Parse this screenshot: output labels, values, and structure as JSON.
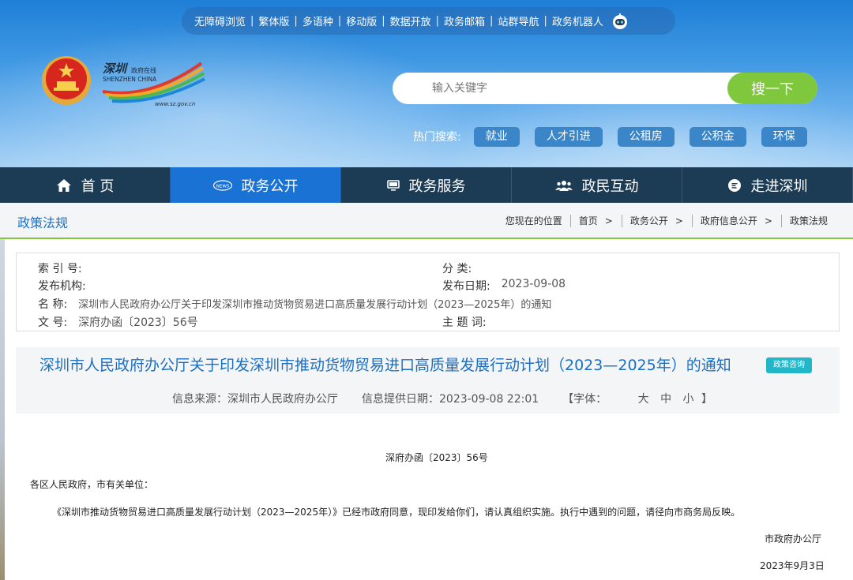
{
  "top_links": [
    "无障碍浏览",
    "繁体版",
    "多语种",
    "移动版",
    "数据开放",
    "政务邮箱",
    "站群导航",
    "政务机器人"
  ],
  "logo": {
    "text_cn": "深圳",
    "text_sub": "政府在线",
    "text_en": "SHENZHEN CHINA",
    "url": "www.sz.gov.cn"
  },
  "search": {
    "placeholder": "输入关键字",
    "button": "搜一下"
  },
  "hot_search": {
    "label": "热门搜索:",
    "tags": [
      "就业",
      "人才引进",
      "公租房",
      "公积金",
      "环保"
    ]
  },
  "nav": [
    {
      "label": "首 页",
      "icon": "home-icon"
    },
    {
      "label": "政务公开",
      "icon": "news-icon",
      "active": true
    },
    {
      "label": "政务服务",
      "icon": "monitor-icon"
    },
    {
      "label": "政民互动",
      "icon": "people-icon"
    },
    {
      "label": "走进深圳",
      "icon": "chat-icon"
    }
  ],
  "breadcrumb": {
    "section": "政策法规",
    "location_label": "您现在的位置",
    "items": [
      "首页",
      "政务公开",
      "政府信息公开",
      "政策法规"
    ]
  },
  "meta": {
    "index_no": {
      "label": "索 引 号:",
      "value": ""
    },
    "category": {
      "label": "分 类:",
      "value": ""
    },
    "publisher": {
      "label": "发布机构:",
      "value": ""
    },
    "publish_date": {
      "label": "发布日期:",
      "value": "2023-09-08"
    },
    "name": {
      "label": "名 称:",
      "value": "深圳市人民政府办公厅关于印发深圳市推动货物贸易进口高质量发展行动计划（2023—2025年）的通知"
    },
    "doc_no": {
      "label": "文 号:",
      "value": "深府办函〔2023〕56号"
    },
    "keywords": {
      "label": "主 题 词:",
      "value": ""
    }
  },
  "article": {
    "title": "深圳市人民政府办公厅关于印发深圳市推动货物贸易进口高质量发展行动计划（2023—2025年）的通知",
    "badge": "政策咨询",
    "source": "信息来源：深圳市人民政府办公厅",
    "provided_date": "信息提供日期：2023-09-08 22:01",
    "font_size_label": "【字体：",
    "font_sizes": [
      "大",
      "中",
      "小"
    ],
    "font_size_end": "】",
    "doc_number": "深府办函〔2023〕56号",
    "addressee": "各区人民政府，市有关单位：",
    "body": "《深圳市推动货物贸易进口高质量发展行动计划（2023—2025年）》已经市政府同意，现印发给你们，请认真组织实施。执行中遇到的问题，请径向市商务局反映。",
    "signature": "市政府办公厅",
    "date": "2023年9月3日"
  }
}
